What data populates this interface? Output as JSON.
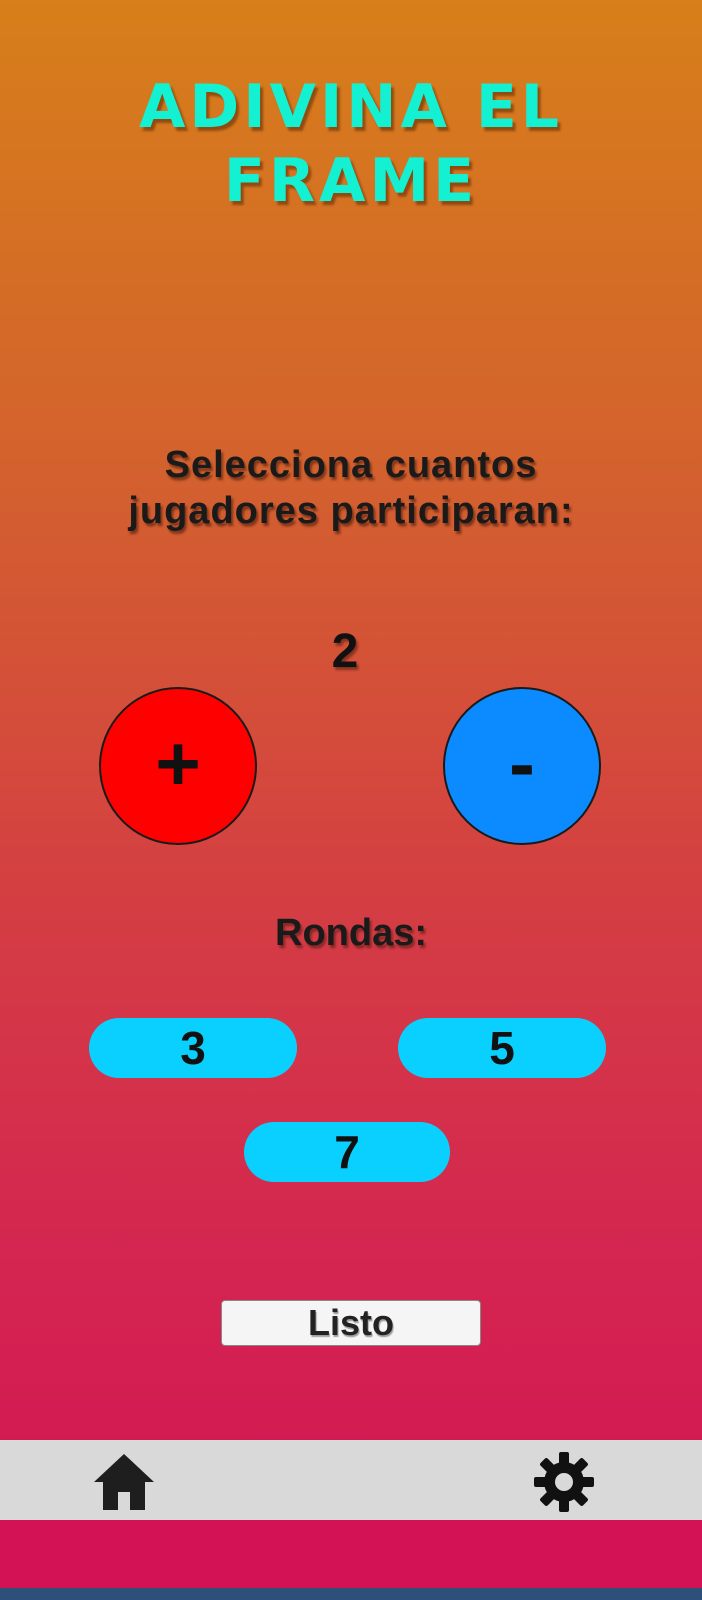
{
  "title": {
    "line1": "ADIVINA EL",
    "line2": "FRAME"
  },
  "players": {
    "prompt_line1": "Selecciona cuantos",
    "prompt_line2": "jugadores participaran:",
    "count": "2",
    "increment_label": "+",
    "decrement_label": "-"
  },
  "rounds": {
    "label": "Rondas:",
    "options": [
      "3",
      "5",
      "7"
    ]
  },
  "done_button": {
    "label": "Listo"
  },
  "navbar": {
    "home_icon": "home-icon",
    "settings_icon": "gear-icon"
  },
  "colors": {
    "title": "#14f0d2",
    "increment_button": "#ff0000",
    "decrement_button": "#0b8bff",
    "round_pill": "#0ad0ff",
    "navbar": "#d9d9d9",
    "gradient_top": "#d77f1a",
    "gradient_bottom": "#d21255"
  }
}
